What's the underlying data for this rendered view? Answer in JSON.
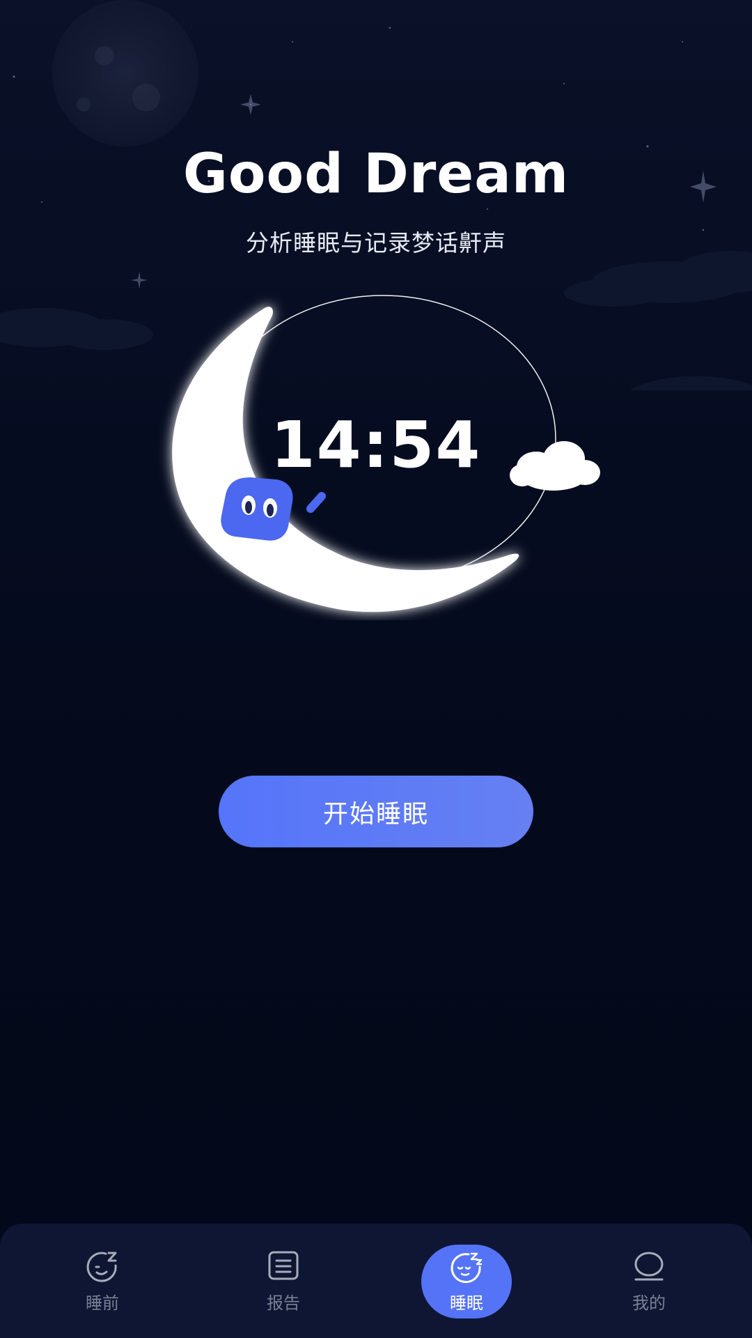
{
  "header": {
    "title": "Good Dream",
    "subtitle": "分析睡眠与记录梦话鼾声"
  },
  "clock": {
    "time": "14:54"
  },
  "actions": {
    "start_label": "开始睡眠"
  },
  "tabbar": {
    "items": [
      {
        "label": "睡前",
        "icon": "sleep-face-icon",
        "active": false
      },
      {
        "label": "报告",
        "icon": "report-doc-icon",
        "active": false
      },
      {
        "label": "睡眠",
        "icon": "sleep-moon-icon",
        "active": true
      },
      {
        "label": "我的",
        "icon": "profile-icon",
        "active": false
      }
    ]
  },
  "colors": {
    "background": "#050a1c",
    "accent": "#5473f6",
    "tabbar_bg": "#0e1633",
    "inactive_label": "#7a8094"
  }
}
